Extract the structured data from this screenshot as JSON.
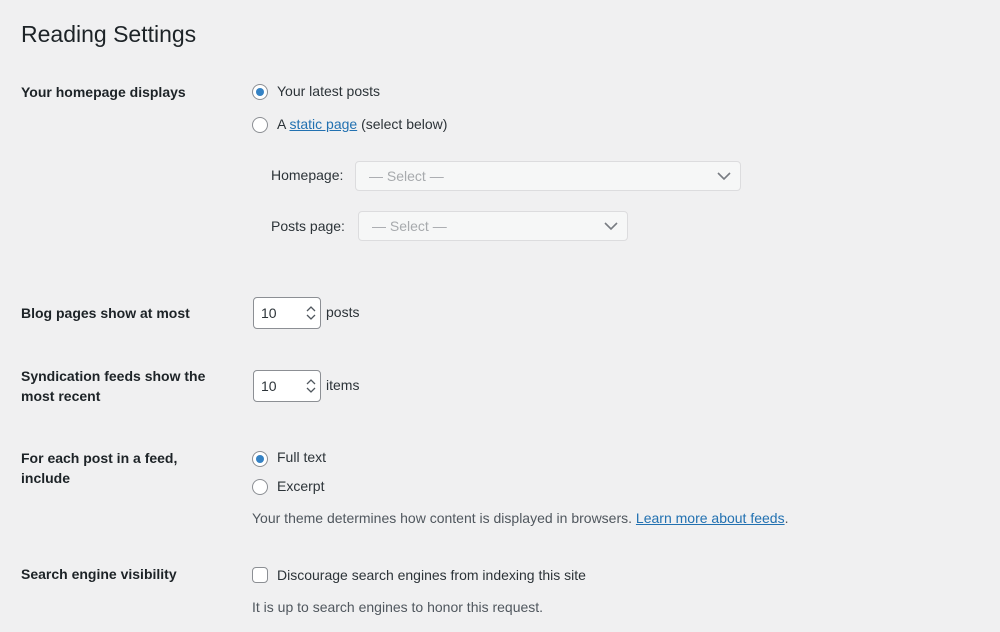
{
  "page": {
    "title": "Reading Settings"
  },
  "homepage_displays": {
    "label": "Your homepage displays",
    "option_latest": "Your latest posts",
    "option_static_prefix": "A",
    "option_static_link": "static page",
    "option_static_suffix": "(select below)",
    "homepage_label": "Homepage:",
    "homepage_select": "— Select —",
    "posts_page_label": "Posts page:",
    "posts_page_select": "— Select —",
    "selected": "latest"
  },
  "blog_pages": {
    "label": "Blog pages show at most",
    "value": "10",
    "unit": "posts"
  },
  "syndication": {
    "label": "Syndication feeds show the most recent",
    "value": "10",
    "unit": "items"
  },
  "feed_include": {
    "label": "For each post in a feed, include",
    "option_full": "Full text",
    "option_excerpt": "Excerpt",
    "selected": "full",
    "description": "Your theme determines how content is displayed in browsers.",
    "link": "Learn more about feeds",
    "link_suffix": "."
  },
  "search_visibility": {
    "label": "Search engine visibility",
    "checkbox_label": "Discourage search engines from indexing this site",
    "checked": false,
    "description": "It is up to search engines to honor this request."
  },
  "colors": {
    "accent": "#2271b1",
    "radio_dot": "#3582c4",
    "background": "#f0f0f1"
  }
}
